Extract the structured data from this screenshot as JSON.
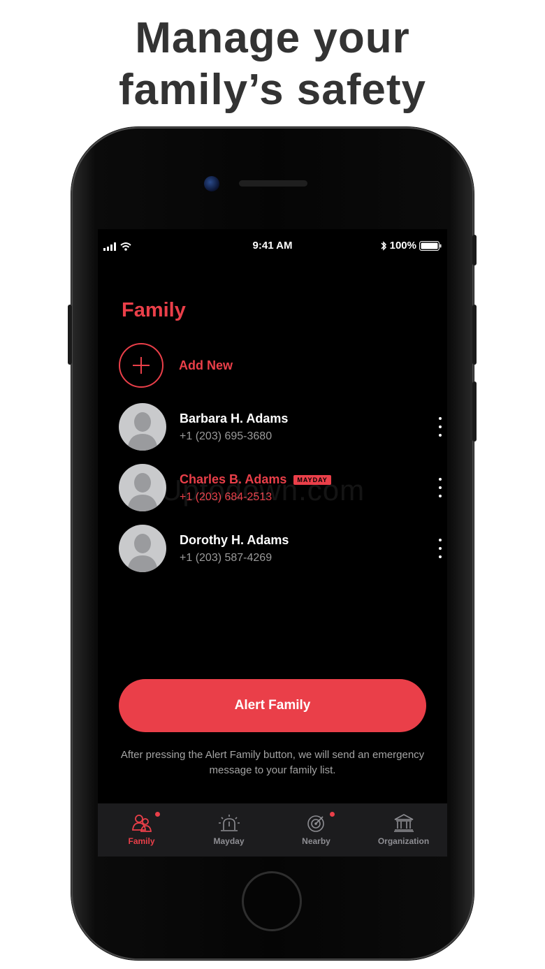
{
  "headline": {
    "line1": "Manage your",
    "line2": "family’s safety"
  },
  "status_bar": {
    "time": "9:41 AM",
    "battery": "100%"
  },
  "screen": {
    "title": "Family",
    "add_new_label": "Add New",
    "members": [
      {
        "name": "Barbara H. Adams",
        "phone": "+1 (203) 695-3680",
        "mayday": false
      },
      {
        "name": "Charles B. Adams",
        "phone": "+1 (203) 684-2513",
        "mayday": true,
        "badge": "MAYDAY"
      },
      {
        "name": "Dorothy H. Adams",
        "phone": "+1 (203) 587-4269",
        "mayday": false
      }
    ],
    "watermark": "Uptodown.com",
    "alert_button_label": "Alert Family",
    "alert_note": "After pressing the Alert Family button, we will send an emergency message to your family list."
  },
  "tabbar": {
    "tabs": [
      {
        "label": "Family",
        "icon": "family-icon",
        "active": true,
        "dot": true
      },
      {
        "label": "Mayday",
        "icon": "siren-icon",
        "active": false,
        "dot": false
      },
      {
        "label": "Nearby",
        "icon": "radar-icon",
        "active": false,
        "dot": true
      },
      {
        "label": "Organization",
        "icon": "bank-icon",
        "active": false,
        "dot": false
      }
    ]
  },
  "colors": {
    "accent": "#ea3f49",
    "screen_bg": "#000000",
    "tabbar_bg": "#1c1c1e",
    "headline": "#333333"
  }
}
